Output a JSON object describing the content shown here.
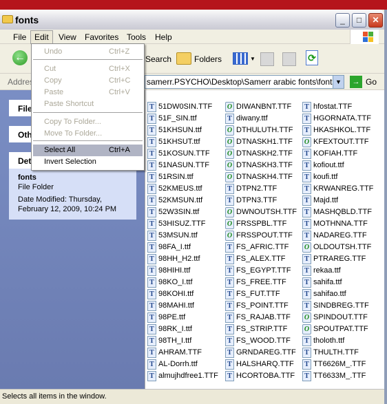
{
  "window": {
    "title": "fonts"
  },
  "menubar": [
    "File",
    "Edit",
    "View",
    "Favorites",
    "Tools",
    "Help"
  ],
  "toolbar": {
    "search": "Search",
    "folders": "Folders"
  },
  "address": {
    "label": "Address",
    "value": "samerr.PSYCHO\\Desktop\\Samerr arabic fonts\\fonts",
    "go": "Go"
  },
  "leftpane": {
    "file_tasks": "File and Folder Tasks",
    "other_places": "Other Places",
    "details": "Details",
    "name": "fonts",
    "type": "File Folder",
    "modified": "Date Modified: Thursday, February 12, 2009, 10:24 PM"
  },
  "edit_menu": [
    {
      "label": "Undo",
      "shortcut": "Ctrl+Z",
      "enabled": false
    },
    {
      "label": "Cut",
      "shortcut": "Ctrl+X",
      "enabled": false
    },
    {
      "label": "Copy",
      "shortcut": "Ctrl+C",
      "enabled": false
    },
    {
      "label": "Paste",
      "shortcut": "Ctrl+V",
      "enabled": false
    },
    {
      "label": "Paste Shortcut",
      "shortcut": "",
      "enabled": false
    },
    {
      "label": "Copy To Folder...",
      "shortcut": "",
      "enabled": false
    },
    {
      "label": "Move To Folder...",
      "shortcut": "",
      "enabled": false
    },
    {
      "label": "Select All",
      "shortcut": "Ctrl+A",
      "enabled": true,
      "highlighted": true
    },
    {
      "label": "Invert Selection",
      "shortcut": "",
      "enabled": true
    }
  ],
  "files": [
    [
      "51DW0SIN.TTF",
      "T"
    ],
    [
      "51F_SIN.ttf",
      "T"
    ],
    [
      "51KHSUN.ttf",
      "T"
    ],
    [
      "51KHSUT.ttf",
      "T"
    ],
    [
      "51KOSUN.TTF",
      "T"
    ],
    [
      "51NASUN.TTF",
      "T"
    ],
    [
      "51RSIN.ttf",
      "T"
    ],
    [
      "52KMEUS.ttf",
      "T"
    ],
    [
      "52KMSUN.ttf",
      "T"
    ],
    [
      "52W3SIN.ttf",
      "T"
    ],
    [
      "53HISUZ.TTF",
      "T"
    ],
    [
      "53MSUN.ttf",
      "T"
    ],
    [
      "98FA_I.ttf",
      "T"
    ],
    [
      "98HH_H2.ttf",
      "T"
    ],
    [
      "98HIHI.ttf",
      "T"
    ],
    [
      "98KO_I.ttf",
      "T"
    ],
    [
      "98KOHI.ttf",
      "T"
    ],
    [
      "98MAHI.ttf",
      "T"
    ],
    [
      "98PE.ttf",
      "T"
    ],
    [
      "98RK_I.ttf",
      "T"
    ],
    [
      "98TH_I.ttf",
      "T"
    ],
    [
      "AHRAM.TTF",
      "T"
    ],
    [
      "AL-Dorrh.ttf",
      "T"
    ],
    [
      "almujhdfree1.TTF",
      "T"
    ],
    [
      "DIWANBNT.TTF",
      "O"
    ],
    [
      "diwany.ttf",
      "T"
    ],
    [
      "DTHULUTH.TTF",
      "O"
    ],
    [
      "DTNASKH1.TTF",
      "O"
    ],
    [
      "DTNASKH2.TTF",
      "O"
    ],
    [
      "DTNASKH3.TTF",
      "O"
    ],
    [
      "DTNASKH4.TTF",
      "O"
    ],
    [
      "DTPN2.TTF",
      "T"
    ],
    [
      "DTPN3.TTF",
      "T"
    ],
    [
      "DWNOUTSH.TTF",
      "O"
    ],
    [
      "FRSSPBL.TTF",
      "O"
    ],
    [
      "FRSSPOUT.TTF",
      "O"
    ],
    [
      "FS_AFRIC.TTF",
      "T"
    ],
    [
      "FS_ALEX.TTF",
      "T"
    ],
    [
      "FS_EGYPT.TTF",
      "T"
    ],
    [
      "FS_FREE.TTF",
      "T"
    ],
    [
      "FS_FUT.TTF",
      "T"
    ],
    [
      "FS_POINT.TTF",
      "T"
    ],
    [
      "FS_RAJAB.TTF",
      "T"
    ],
    [
      "FS_STRIP.TTF",
      "T"
    ],
    [
      "FS_WOOD.TTF",
      "T"
    ],
    [
      "GRNDAREG.TTF",
      "T"
    ],
    [
      "HALSHARQ.TTF",
      "T"
    ],
    [
      "HCORTOBA.TTF",
      "T"
    ],
    [
      "hfostat.TTF",
      "T"
    ],
    [
      "HGORNATA.TTF",
      "T"
    ],
    [
      "HKASHKOL.TTF",
      "T"
    ],
    [
      "KFEXTOUT.TTF",
      "O"
    ],
    [
      "KOFIAH.TTF",
      "T"
    ],
    [
      "kofiout.ttf",
      "T"
    ],
    [
      "koufi.ttf",
      "T"
    ],
    [
      "KRWANREG.TTF",
      "T"
    ],
    [
      "Majd.ttf",
      "T"
    ],
    [
      "MASHQBLD.TTF",
      "T"
    ],
    [
      "MOTHNNA.TTF",
      "T"
    ],
    [
      "NADAREG.TTF",
      "T"
    ],
    [
      "OLDOUTSH.TTF",
      "O"
    ],
    [
      "PTRAREG.TTF",
      "T"
    ],
    [
      "rekaa.ttf",
      "T"
    ],
    [
      "sahifa.ttf",
      "T"
    ],
    [
      "sahifao.ttf",
      "T"
    ],
    [
      "SINDBREG.TTF",
      "T"
    ],
    [
      "SPINDOUT.TTF",
      "O"
    ],
    [
      "SPOUTPAT.TTF",
      "O"
    ],
    [
      "tholoth.ttf",
      "T"
    ],
    [
      "THULTH.TTF",
      "T"
    ],
    [
      "TT6626M_.TTF",
      "T"
    ],
    [
      "TT6633M_.TTF",
      "T"
    ]
  ],
  "status": "Selects all items in the window."
}
